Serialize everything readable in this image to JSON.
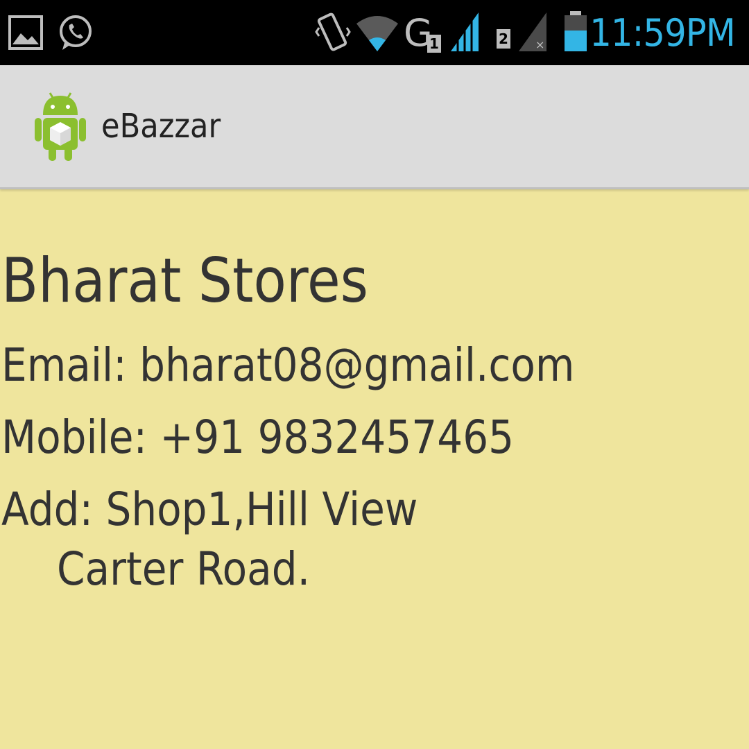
{
  "status_bar": {
    "time": "11:59PM",
    "icons": [
      "gallery-icon",
      "whatsapp-icon",
      "vibrate-icon",
      "wifi-icon",
      "network-g-sim1-icon",
      "signal-sim1-icon",
      "signal-sim2-icon",
      "battery-icon"
    ],
    "sim1_label": "G",
    "sim1_badge": "1",
    "sim2_badge": "2",
    "accent_color": "#33b5e5"
  },
  "action_bar": {
    "title": "eBazzar",
    "icon": "android-app-icon"
  },
  "store": {
    "name": "Bharat Stores",
    "email": "Email: bharat08@gmail.com",
    "mobile": "Mobile: +91 9832457465",
    "address_line1": "Add: Shop1,Hill View",
    "address_line2": "Carter Road."
  },
  "colors": {
    "background": "#efe59d",
    "action_bar": "#dcdcdc",
    "text": "#333333"
  }
}
